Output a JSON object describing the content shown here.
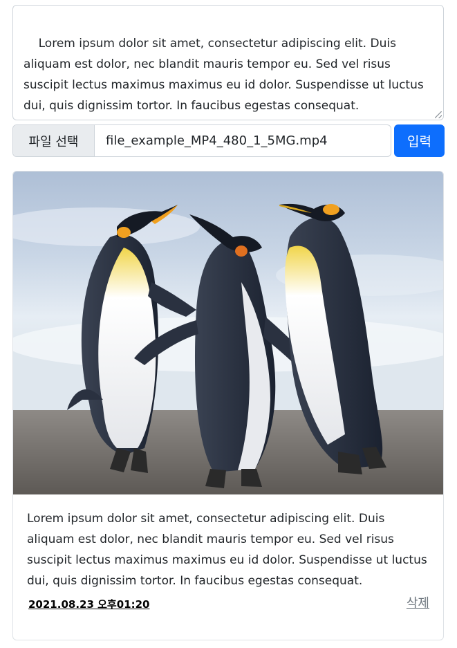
{
  "composer": {
    "text": "Lorem ipsum dolor sit amet, consectetur adipiscing elit. Duis aliquam est dolor, nec blandit mauris tempor eu. Sed vel risus suscipit lectus maximus maximus eu id dolor. Suspendisse ut luctus dui, quis dignissim tortor. In faucibus egestas consequat."
  },
  "upload": {
    "choose_label": "파일 선택",
    "file_name": "file_example_MP4_480_1_5MG.mp4",
    "submit_label": "입력"
  },
  "post": {
    "image_subject": "penguins-photo",
    "text": "Lorem ipsum dolor sit amet, consectetur adipiscing elit. Duis aliquam est dolor, nec blandit mauris tempor eu. Sed vel risus suscipit lectus maximus maximus eu id dolor. Suspendisse ut luctus dui, quis dignissim tortor. In faucibus egestas consequat.",
    "date": "2021.08.23 오후01:20",
    "delete_label": "삭제"
  },
  "colors": {
    "primary": "#0d6efd",
    "border": "#ced4da",
    "muted": "#6c757d"
  }
}
